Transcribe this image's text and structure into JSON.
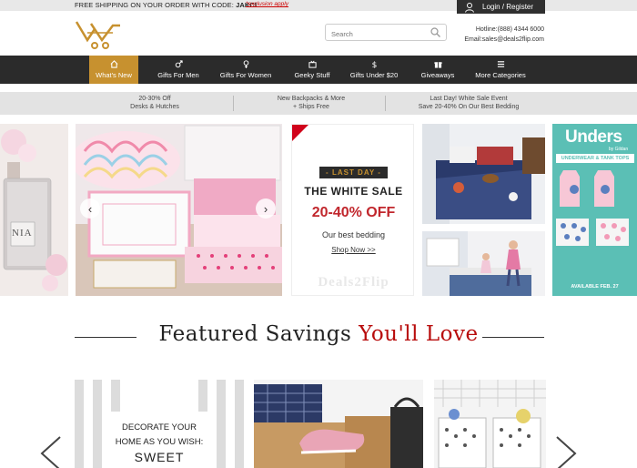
{
  "topbar": {
    "promo_text": "FREE SHIPPING ON YOUR ORDER WITH CODE: ",
    "promo_code": "JAKCI",
    "exclusion": "*exclusion apply",
    "login_label": "Login / Register"
  },
  "header": {
    "search_placeholder": "Search",
    "hotline": "Hotline:(888) 4344 6000",
    "email": "Email:sales@deals2flip.com"
  },
  "nav": {
    "items": [
      {
        "label": "What's New",
        "icon": "home-icon"
      },
      {
        "label": "Gifts For Men",
        "icon": "male-icon"
      },
      {
        "label": "Gifts For Women",
        "icon": "female-icon"
      },
      {
        "label": "Geeky Stuff",
        "icon": "tv-icon"
      },
      {
        "label": "Gifts Under $20",
        "icon": "dollar-icon"
      },
      {
        "label": "Giveaways",
        "icon": "gift-icon"
      },
      {
        "label": "More Categories",
        "icon": "menu-icon"
      }
    ]
  },
  "subbar": {
    "items": [
      {
        "line1": "20-30% Off",
        "line2": "Desks & Hutches"
      },
      {
        "line1": "New Backpacks & More",
        "line2": "+ Ships Free"
      },
      {
        "line1": "Last Day! White Sale Event",
        "line2": "Save 20-40% On Our Best Bedding"
      }
    ]
  },
  "carousel": {
    "perfume_label": "NIA",
    "sale": {
      "badge": "LAST DAY",
      "title": "THE WHITE SALE",
      "discount": "20-40% OFF",
      "subtitle": "Our best bedding",
      "cta": "Shop Now >>",
      "watermark": "Deals2Flip"
    },
    "unders": {
      "brand": "Unders",
      "by": "by Gildan",
      "banner": "UNDERWEAR & TANK TOPS",
      "available": "AVAILABLE FEB. 27"
    }
  },
  "featured": {
    "heading_main": "Featured Savings ",
    "heading_accent": "You'll Love"
  },
  "cards": {
    "decorate_line1": "DECORATE YOUR",
    "decorate_line2": "HOME AS YOU WISH:",
    "decorate_line3": "SWEET"
  },
  "colors": {
    "accent_gold": "#c7912f",
    "nav_dark": "#2b2b2b",
    "sale_red": "#c1272d",
    "heading_red": "#b80c0c",
    "teal": "#5bbfb5"
  }
}
